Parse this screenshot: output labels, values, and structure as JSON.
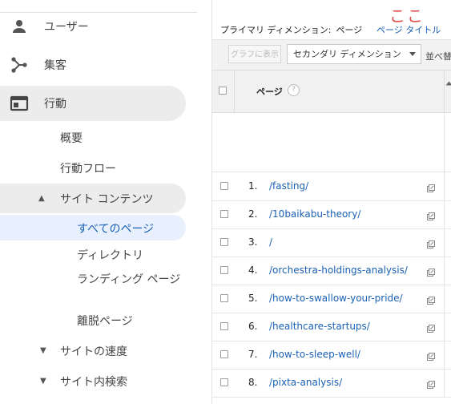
{
  "sidebar": {
    "users": "ユーザー",
    "acquisition": "集客",
    "behavior": "行動",
    "overview": "概要",
    "behavior_flow": "行動フロー",
    "site_content": "サイト コンテンツ",
    "all_pages": "すべてのページ",
    "directory": "ディレクトリ",
    "landing_pages": "ランディング ページ",
    "exit_pages": "離脱ページ",
    "site_speed": "サイトの速度",
    "site_search": "サイト内検索"
  },
  "annotation": "ここ",
  "dimension_bar": {
    "label": "プライマリ ディメンション:",
    "current": "ページ",
    "alternative": "ページ タイトル"
  },
  "toolbar": {
    "graph_button": "グラフに表示",
    "secondary_dimension": "セカンダリ ディメンション",
    "sort_label": "並べ替"
  },
  "table": {
    "column_page": "ページ",
    "help": "?",
    "rows": [
      {
        "num": "1.",
        "path": "/fasting/"
      },
      {
        "num": "2.",
        "path": "/10baikabu-theory/"
      },
      {
        "num": "3.",
        "path": "/"
      },
      {
        "num": "4.",
        "path": "/orchestra-holdings-analysis/"
      },
      {
        "num": "5.",
        "path": "/how-to-swallow-your-pride/"
      },
      {
        "num": "6.",
        "path": "/healthcare-startups/"
      },
      {
        "num": "7.",
        "path": "/how-to-sleep-well/"
      },
      {
        "num": "8.",
        "path": "/pixta-analysis/"
      }
    ]
  },
  "icons": [
    "person-icon",
    "acquisition-icon",
    "behavior-icon",
    "external-link-icon"
  ],
  "colors": {
    "link": "#1a60b4",
    "annotation": "#e0514a",
    "selected_bg": "#e8f0fe",
    "active_bg": "#ececec"
  }
}
